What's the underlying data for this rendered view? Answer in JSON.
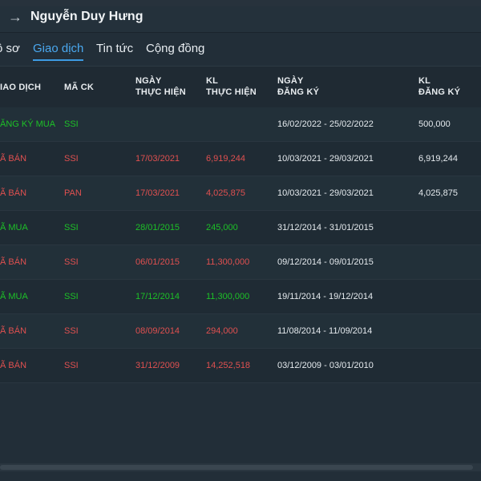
{
  "header": {
    "title": "Nguyễn Duy Hưng"
  },
  "tabs": [
    {
      "label": "ồ sơ",
      "active": false
    },
    {
      "label": "Giao dịch",
      "active": true
    },
    {
      "label": "Tin tức",
      "active": false
    },
    {
      "label": "Cộng đồng",
      "active": false
    }
  ],
  "table": {
    "columns": {
      "type": "IAO DỊCH",
      "symbol": "MÃ CK",
      "exec_date_1": "NGÀY",
      "exec_date_2": "THỰC HIỆN",
      "exec_vol_1": "KL",
      "exec_vol_2": "THỰC HIỆN",
      "reg_date_1": "NGÀY",
      "reg_date_2": "ĐĂNG KÝ",
      "reg_vol_1": "KL",
      "reg_vol_2": "ĐĂNG KÝ"
    },
    "rows": [
      {
        "type": "ĂNG KÝ MUA",
        "symbol": "SSI",
        "exec_date": "",
        "exec_vol": "",
        "reg_date": "16/02/2022 - 25/02/2022",
        "reg_vol": "500,000",
        "color": "green"
      },
      {
        "type": "Ã BÁN",
        "symbol": "SSI",
        "exec_date": "17/03/2021",
        "exec_vol": "6,919,244",
        "reg_date": "10/03/2021 - 29/03/2021",
        "reg_vol": "6,919,244",
        "color": "red"
      },
      {
        "type": "Ã BÁN",
        "symbol": "PAN",
        "exec_date": "17/03/2021",
        "exec_vol": "4,025,875",
        "reg_date": "10/03/2021 - 29/03/2021",
        "reg_vol": "4,025,875",
        "color": "red"
      },
      {
        "type": "Ã MUA",
        "symbol": "SSI",
        "exec_date": "28/01/2015",
        "exec_vol": "245,000",
        "reg_date": "31/12/2014 - 31/01/2015",
        "reg_vol": "",
        "color": "green"
      },
      {
        "type": "Ã BÁN",
        "symbol": "SSI",
        "exec_date": "06/01/2015",
        "exec_vol": "11,300,000",
        "reg_date": "09/12/2014 - 09/01/2015",
        "reg_vol": "",
        "color": "red"
      },
      {
        "type": "Ã MUA",
        "symbol": "SSI",
        "exec_date": "17/12/2014",
        "exec_vol": "11,300,000",
        "reg_date": "19/11/2014 - 19/12/2014",
        "reg_vol": "",
        "color": "green"
      },
      {
        "type": "Ã BÁN",
        "symbol": "SSI",
        "exec_date": "08/09/2014",
        "exec_vol": "294,000",
        "reg_date": "11/08/2014 - 11/09/2014",
        "reg_vol": "",
        "color": "red"
      },
      {
        "type": "Ã BÁN",
        "symbol": "SSI",
        "exec_date": "31/12/2009",
        "exec_vol": "14,252,518",
        "reg_date": "03/12/2009 - 03/01/2010",
        "reg_vol": "",
        "color": "red"
      }
    ]
  },
  "colors": {
    "buy": "#1dc127",
    "sell": "#e05050",
    "accent": "#4aa8ef",
    "background": "#222e38"
  },
  "icons": {
    "back": "arrow-right-icon"
  }
}
